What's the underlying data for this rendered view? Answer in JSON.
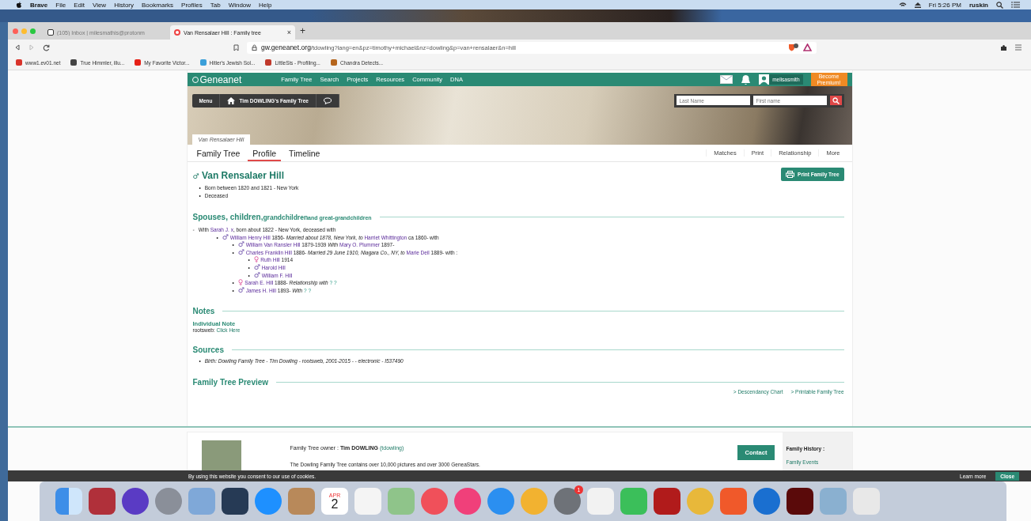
{
  "menu_bar": {
    "app": "Brave",
    "items": [
      "File",
      "Edit",
      "View",
      "History",
      "Bookmarks",
      "Profiles",
      "Tab",
      "Window",
      "Help"
    ],
    "clock": "Fri 5:26 PM",
    "user": "ruskin"
  },
  "browser": {
    "tabs": [
      {
        "label": "(105) Inbox | milesmathis@protonm",
        "selected": false
      },
      {
        "label": "Van Rensalaer Hill : Family tree",
        "selected": true,
        "close": "×"
      }
    ],
    "new_tab": "+",
    "url_host": "gw.geneanet.org",
    "url_path": "/tdowling?lang=en&pz=timothy+michael&nz=dowling&p=van+rensalaer&n=hill",
    "bookmarks": [
      {
        "label": "www1.ev01.net",
        "color": "#d9342b"
      },
      {
        "label": "True Himmler, illu...",
        "color": "#444444"
      },
      {
        "label": "My Favorite Victor...",
        "color": "#e62117"
      },
      {
        "label": "Hitler's Jewish Sol...",
        "color": "#3b9fd9"
      },
      {
        "label": "LittleSis - Profiling...",
        "color": "#c0392b"
      },
      {
        "label": "Chandra Detects...",
        "color": "#b5651d"
      }
    ]
  },
  "site": {
    "logo": "Geneanet",
    "nav": [
      "Family Tree",
      "Search",
      "Projects",
      "Resources",
      "Community",
      "DNA"
    ],
    "username": "melisasmith",
    "premium": "Become Premium!",
    "menu_button": "Menu",
    "tree_button": "Tim DOWLING's Family Tree",
    "search": {
      "last_name": {
        "placeholder": "Last Name"
      },
      "first_name": {
        "placeholder": "First name"
      }
    },
    "breadcrumb": "Van Rensalaer Hill",
    "page_tabs": [
      {
        "label": "Family Tree",
        "selected": false
      },
      {
        "label": "Profile",
        "selected": true
      },
      {
        "label": "Timeline",
        "selected": false
      }
    ],
    "actions": [
      "Matches",
      "Print",
      "Relationship",
      "More"
    ]
  },
  "person": {
    "sign": "♂",
    "name": "Van Rensalaer Hill",
    "facts": [
      {
        "marker": "•",
        "text": "Born between 1820 and 1821 - New York"
      },
      {
        "marker": "•",
        "text": "Deceased"
      }
    ],
    "print_button": "Print Family Tree"
  },
  "family": {
    "heading": [
      {
        "t": "Spouses, children,",
        "kind": "large"
      },
      {
        "t": "grandchildren",
        "kind": "medium"
      },
      {
        "t": "and great-grandchildren",
        "kind": "small"
      }
    ],
    "spouse": {
      "marker": "◦",
      "segments": [
        {
          "t": "With ",
          "kind": "text"
        },
        {
          "t": "Sarah J. x",
          "kind": "link"
        },
        {
          "t": ", born about 1822 - New York, deceased with",
          "kind": "small"
        }
      ]
    },
    "children": [
      {
        "marker": "•",
        "sign": "♂",
        "kind": "male",
        "segments": [
          {
            "t": "William Henry Hill",
            "kind": "link"
          },
          {
            "t": " 1856- ",
            "kind": "text"
          },
          {
            "t": " Married about 1878, ",
            "kind": "italic"
          },
          {
            "t": "New York, ",
            "kind": "italic"
          },
          {
            "t": "to ",
            "kind": "italic"
          },
          {
            "t": "Harriet Whittington",
            "kind": "link"
          },
          {
            "t": " ca 1860- with",
            "kind": "text"
          }
        ],
        "children": [
          {
            "marker": "•",
            "sign": "♂",
            "kind": "male",
            "segments": [
              {
                "t": "William Van Ransler Hill",
                "kind": "link"
              },
              {
                "t": " 1879-1939 ",
                "kind": "text"
              },
              {
                "t": "With ",
                "kind": "italic"
              },
              {
                "t": "Mary O. Plummer",
                "kind": "link"
              },
              {
                "t": " 1897-",
                "kind": "text"
              }
            ]
          },
          {
            "marker": "•",
            "sign": "♂",
            "kind": "male",
            "segments": [
              {
                "t": "Charles Franklin Hill",
                "kind": "link"
              },
              {
                "t": " 1886- ",
                "kind": "text"
              },
              {
                "t": "Married 29 June 1910, Niagara Co., NY, to ",
                "kind": "italic"
              },
              {
                "t": "Marie Deil",
                "kind": "link"
              },
              {
                "t": " 1889- with :",
                "kind": "text"
              }
            ],
            "children": [
              {
                "marker": "•",
                "sign": "♀",
                "kind": "female",
                "segments": [
                  {
                    "t": "Ruth Hill",
                    "kind": "link"
                  },
                  {
                    "t": " 1914",
                    "kind": "text"
                  }
                ]
              },
              {
                "marker": "•",
                "sign": "♂",
                "kind": "male",
                "segments": [
                  {
                    "t": "Harold Hill",
                    "kind": "link"
                  }
                ]
              },
              {
                "marker": "•",
                "sign": "♂",
                "kind": "male",
                "segments": [
                  {
                    "t": "William F. Hill",
                    "kind": "link"
                  }
                ]
              }
            ]
          },
          {
            "marker": "•",
            "sign": "♀",
            "kind": "female",
            "segments": [
              {
                "t": "Sarah E. Hill",
                "kind": "link"
              },
              {
                "t": " 1888- ",
                "kind": "text"
              },
              {
                "t": "Relationship with ",
                "kind": "italic"
              },
              {
                "t": "? ?",
                "kind": "teal"
              }
            ]
          },
          {
            "marker": "•",
            "sign": "♂",
            "kind": "male",
            "segments": [
              {
                "t": "James H. Hill",
                "kind": "link"
              },
              {
                "t": " 1893- ",
                "kind": "text"
              },
              {
                "t": "With ",
                "kind": "italic"
              },
              {
                "t": "? ?",
                "kind": "teal"
              }
            ]
          }
        ]
      }
    ]
  },
  "notes": {
    "heading": "Notes",
    "title": "Individual Note",
    "label": "rootsweb: ",
    "link": "Click Here"
  },
  "sources": {
    "heading": "Sources",
    "items": [
      {
        "marker": "•",
        "text": "Birth: Dowling Family Tree - Tim Dowling - rootsweb, 2001-2015 - - electronic - I537490"
      }
    ]
  },
  "preview": {
    "heading": "Family Tree Preview",
    "links": [
      {
        "arrow": ">",
        "label": "Descendancy Chart"
      },
      {
        "arrow": ">",
        "label": "Printable Family Tree"
      }
    ]
  },
  "footer": {
    "owner_label": "Family Tree owner : ",
    "owner_name": "Tim DOWLING",
    "owner_id": "(tdowling)",
    "description": "The Dowling Family Tree contains over 10,000 pictures and over 3000 GeneaStars.",
    "contact": "Contact",
    "history_heading": "Family History :",
    "history_links": [
      "Family Events"
    ]
  },
  "cookie_bar": {
    "text": "By using this website you consent to our use of cookies.",
    "learn_more": "Learn more",
    "close": "Close"
  },
  "dock": [
    {
      "kind": "finder",
      "color": "#3d8ee8"
    },
    {
      "kind": "square",
      "color": "#b0303a"
    },
    {
      "kind": "round",
      "color": "#5a3bc4"
    },
    {
      "kind": "round",
      "color": "#8a8f99"
    },
    {
      "kind": "square",
      "color": "#7fa8d8"
    },
    {
      "kind": "square",
      "color": "#263a55"
    },
    {
      "kind": "round",
      "color": "#1e90ff"
    },
    {
      "kind": "square",
      "color": "#b8895a"
    },
    {
      "kind": "calendar",
      "color": "#ffffff",
      "month": "APR",
      "day": "2"
    },
    {
      "kind": "square",
      "color": "#f4f4f4"
    },
    {
      "kind": "square",
      "color": "#8fc48a"
    },
    {
      "kind": "round",
      "color": "#f0505a"
    },
    {
      "kind": "round",
      "color": "#f0407a"
    },
    {
      "kind": "round",
      "color": "#2b8ff0"
    },
    {
      "kind": "round",
      "color": "#f2b230"
    },
    {
      "kind": "badge",
      "color": "#6e7278",
      "badge": "1"
    },
    {
      "kind": "square",
      "color": "#f2f2f2"
    },
    {
      "kind": "square",
      "color": "#3bbf5a"
    },
    {
      "kind": "square",
      "color": "#b11b1b"
    },
    {
      "kind": "round",
      "color": "#e8b83a"
    },
    {
      "kind": "square",
      "color": "#f0592a"
    },
    {
      "kind": "round",
      "color": "#1a6fd0"
    },
    {
      "kind": "square",
      "color": "#5a0a0a"
    },
    {
      "kind": "square",
      "color": "#8ab0d0"
    },
    {
      "kind": "square",
      "color": "#e8e8e8"
    }
  ]
}
